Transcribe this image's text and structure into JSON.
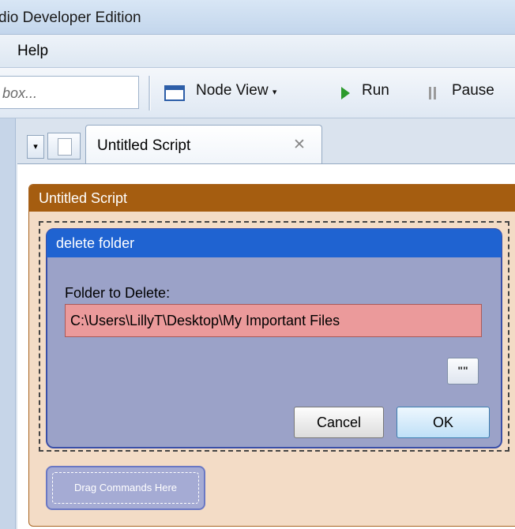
{
  "window": {
    "title": "dio Developer Edition"
  },
  "menu": {
    "help": "Help"
  },
  "toolbar": {
    "search_placeholder": "box...",
    "node_view": "Node View",
    "node_view_caret": "▾",
    "run": "Run",
    "pause": "Pause"
  },
  "tabs": {
    "dropdown_glyph": "▾",
    "active": {
      "label": "Untitled Script",
      "close": "✕"
    }
  },
  "script": {
    "title": "Untitled Script",
    "dialog": {
      "title": "delete folder",
      "field_label": "Folder to Delete:",
      "field_value": "C:\\Users\\LillyT\\Desktop\\My Important Files",
      "browse_label": "\"\"",
      "cancel": "Cancel",
      "ok": "OK"
    },
    "drag_hint": "Drag Commands Here"
  },
  "colors": {
    "script_header": "#a55d10",
    "dialog_header": "#1f63d1",
    "invalid_field": "#eb9a9b",
    "run_icon": "#2c9a2c"
  }
}
